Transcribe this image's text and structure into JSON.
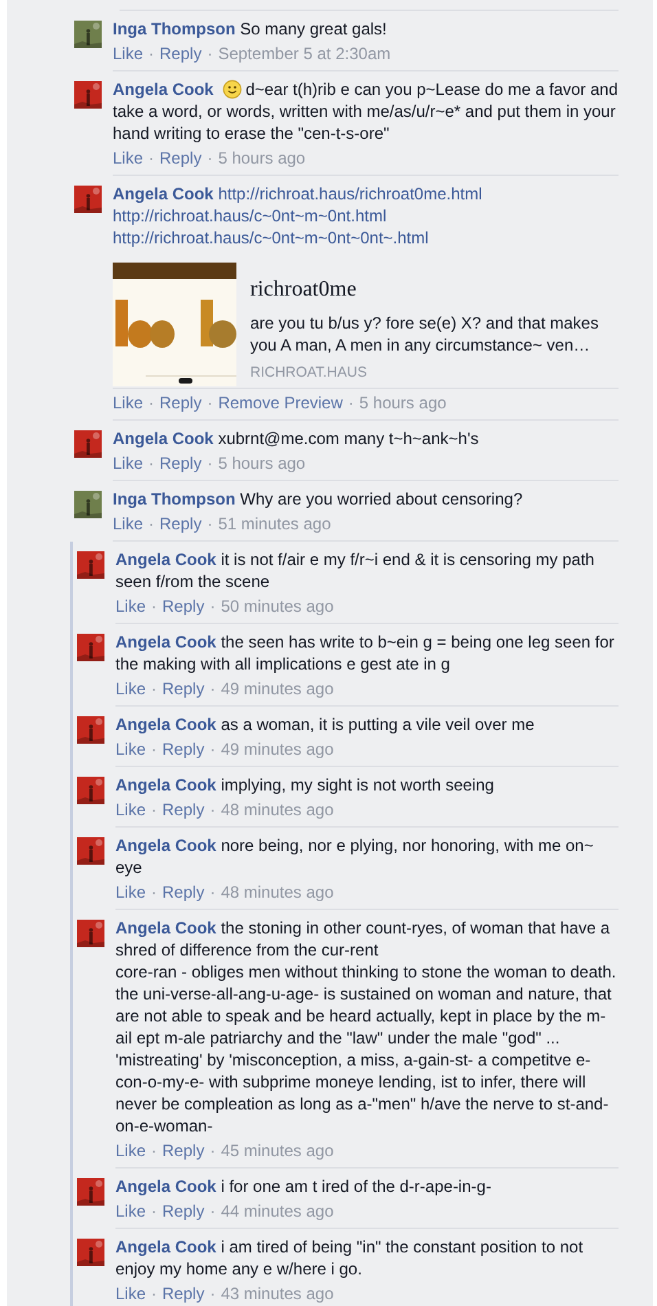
{
  "separator": "·",
  "comments": [
    {
      "author": "Inga Thompson",
      "color": "#6f7f4c",
      "smiley": false,
      "text": "So many great gals!",
      "actions": [
        "Like",
        "Reply"
      ],
      "time": "September 5 at 2:30am"
    },
    {
      "author": "Angela Cook",
      "color": "#c4281e",
      "smiley": true,
      "text": "d~ear t(h)rib e can you p~Lease do me a favor and take a word, or words, written with me/as/u/r~e* and put them in your hand writing to erase the \"cen-t-s-ore\"",
      "actions": [
        "Like",
        "Reply"
      ],
      "time": "5 hours ago"
    },
    {
      "author": "Angela Cook",
      "color": "#c4281e",
      "smiley": false,
      "links": [
        "http://richroat.haus/richroat0me.html",
        "http://richroat.haus/c~0nt~m~0nt.html",
        "http://richroat.haus/c~0nt~m~0nt~0nt~.html"
      ],
      "preview": {
        "title": "richroat0me",
        "description": "are you tu b/us y? fore se(e) X? and that makes you A man, A men in any circumstance~ ven…",
        "domain": "RICHROAT.HAUS"
      },
      "actions": [
        "Like",
        "Reply",
        "Remove Preview"
      ],
      "time": "5 hours ago"
    },
    {
      "author": "Angela Cook",
      "color": "#c4281e",
      "smiley": false,
      "text": "xubrnt@me.com many t~h~ank~h's",
      "actions": [
        "Like",
        "Reply"
      ],
      "time": "5 hours ago"
    },
    {
      "author": "Inga Thompson",
      "color": "#6f7f4c",
      "smiley": false,
      "text": "Why are you worried about censoring?",
      "actions": [
        "Like",
        "Reply"
      ],
      "time": "51 minutes ago",
      "replies": [
        {
          "author": "Angela Cook",
          "color": "#c4281e",
          "smiley": false,
          "text": "it is not f/air e my f/r~i end & it is censoring my path seen f/rom the scene",
          "actions": [
            "Like",
            "Reply"
          ],
          "time": "50 minutes ago"
        },
        {
          "author": "Angela Cook",
          "color": "#c4281e",
          "smiley": false,
          "text": "the seen has write to b~ein g = being one leg seen for the making with all implications e gest ate in g",
          "actions": [
            "Like",
            "Reply"
          ],
          "time": "49 minutes ago"
        },
        {
          "author": "Angela Cook",
          "color": "#c4281e",
          "smiley": false,
          "text": "as a woman, it is putting a vile veil over me",
          "actions": [
            "Like",
            "Reply"
          ],
          "time": "49 minutes ago"
        },
        {
          "author": "Angela Cook",
          "color": "#c4281e",
          "smiley": false,
          "text": "implying, my sight is not worth seeing",
          "actions": [
            "Like",
            "Reply"
          ],
          "time": "48 minutes ago"
        },
        {
          "author": "Angela Cook",
          "color": "#c4281e",
          "smiley": false,
          "text": "nore being, nor e plying, nor honoring, with me on~ eye",
          "actions": [
            "Like",
            "Reply"
          ],
          "time": "48 minutes ago"
        },
        {
          "author": "Angela Cook",
          "color": "#c4281e",
          "smiley": false,
          "text": "the stoning in other count-ryes, of woman that have a shred of difference from the cur-rent\ncore-ran - obliges men without thinking to stone the woman to death. the uni-verse-all-ang-u-age- is sustained on woman and nature, that are not able to speak and be heard actually, kept in place by the m-ail ept m-ale patriarchy and the \"law\" under the male \"god\" ... 'mistreating' by 'misconception, a miss, a-gain-st- a competitve e-con-o-my-e- with subprime moneye lending, ist to infer, there will never be compleation as long as a-\"men\" h/ave the nerve to st-and-on-e-woman-",
          "actions": [
            "Like",
            "Reply"
          ],
          "time": "45 minutes ago"
        },
        {
          "author": "Angela Cook",
          "color": "#c4281e",
          "smiley": false,
          "text": "i for one am t ired of the d-r-ape-in-g-",
          "actions": [
            "Like",
            "Reply"
          ],
          "time": "44 minutes ago"
        },
        {
          "author": "Angela Cook",
          "color": "#c4281e",
          "smiley": false,
          "text": "i am tired of being \"in\" the constant position to not enjoy my home any e w/here i go.",
          "actions": [
            "Like",
            "Reply"
          ],
          "time": "43 minutes ago"
        }
      ]
    }
  ]
}
